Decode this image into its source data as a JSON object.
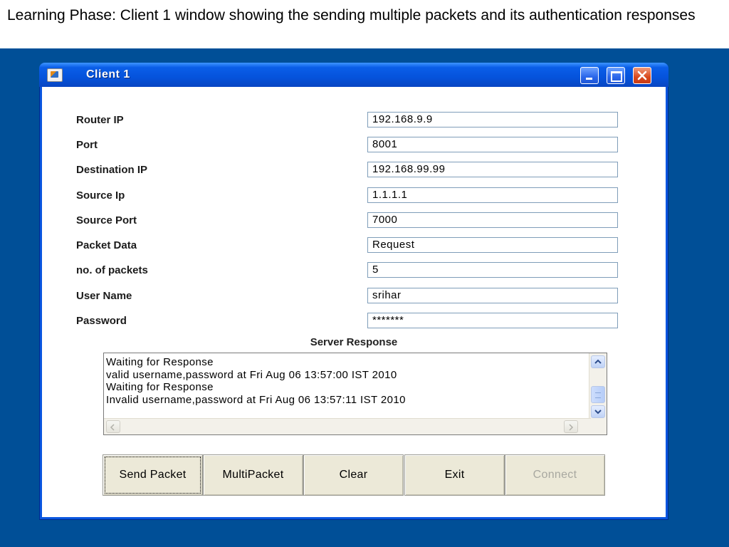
{
  "caption": "Learning Phase: Client 1 window showing the sending multiple packets and its authentication responses",
  "window": {
    "title": "Client 1",
    "icon": "java-cup-icon"
  },
  "form": {
    "router_ip": {
      "label": "Router IP",
      "value": "192.168.9.9"
    },
    "port": {
      "label": "Port",
      "value": "8001"
    },
    "destination_ip": {
      "label": "Destination IP",
      "value": "192.168.99.99"
    },
    "source_ip": {
      "label": "Source Ip",
      "value": "1.1.1.1"
    },
    "source_port": {
      "label": "Source Port",
      "value": "7000"
    },
    "packet_data": {
      "label": "Packet Data",
      "value": "Request"
    },
    "num_packets": {
      "label": "no. of packets",
      "value": "5"
    },
    "user_name": {
      "label": "User Name",
      "value": "srihar"
    },
    "password": {
      "label": "Password",
      "value": "*******"
    }
  },
  "server_response": {
    "label": "Server Response",
    "lines": [
      "Waiting for Response",
      "valid username,password at Fri Aug 06 13:57:00 IST 2010",
      "Waiting for Response",
      "Invalid username,password at Fri Aug 06 13:57:11 IST 2010"
    ]
  },
  "buttons": {
    "send_packet": "Send Packet",
    "multi_packet": "MultiPacket",
    "clear": "Clear",
    "exit": "Exit",
    "connect": "Connect"
  },
  "colors": {
    "slide_background": "#004f97",
    "title_bar": "#0553dc",
    "close_button": "#d9491e",
    "button_face": "#ece9d8"
  }
}
